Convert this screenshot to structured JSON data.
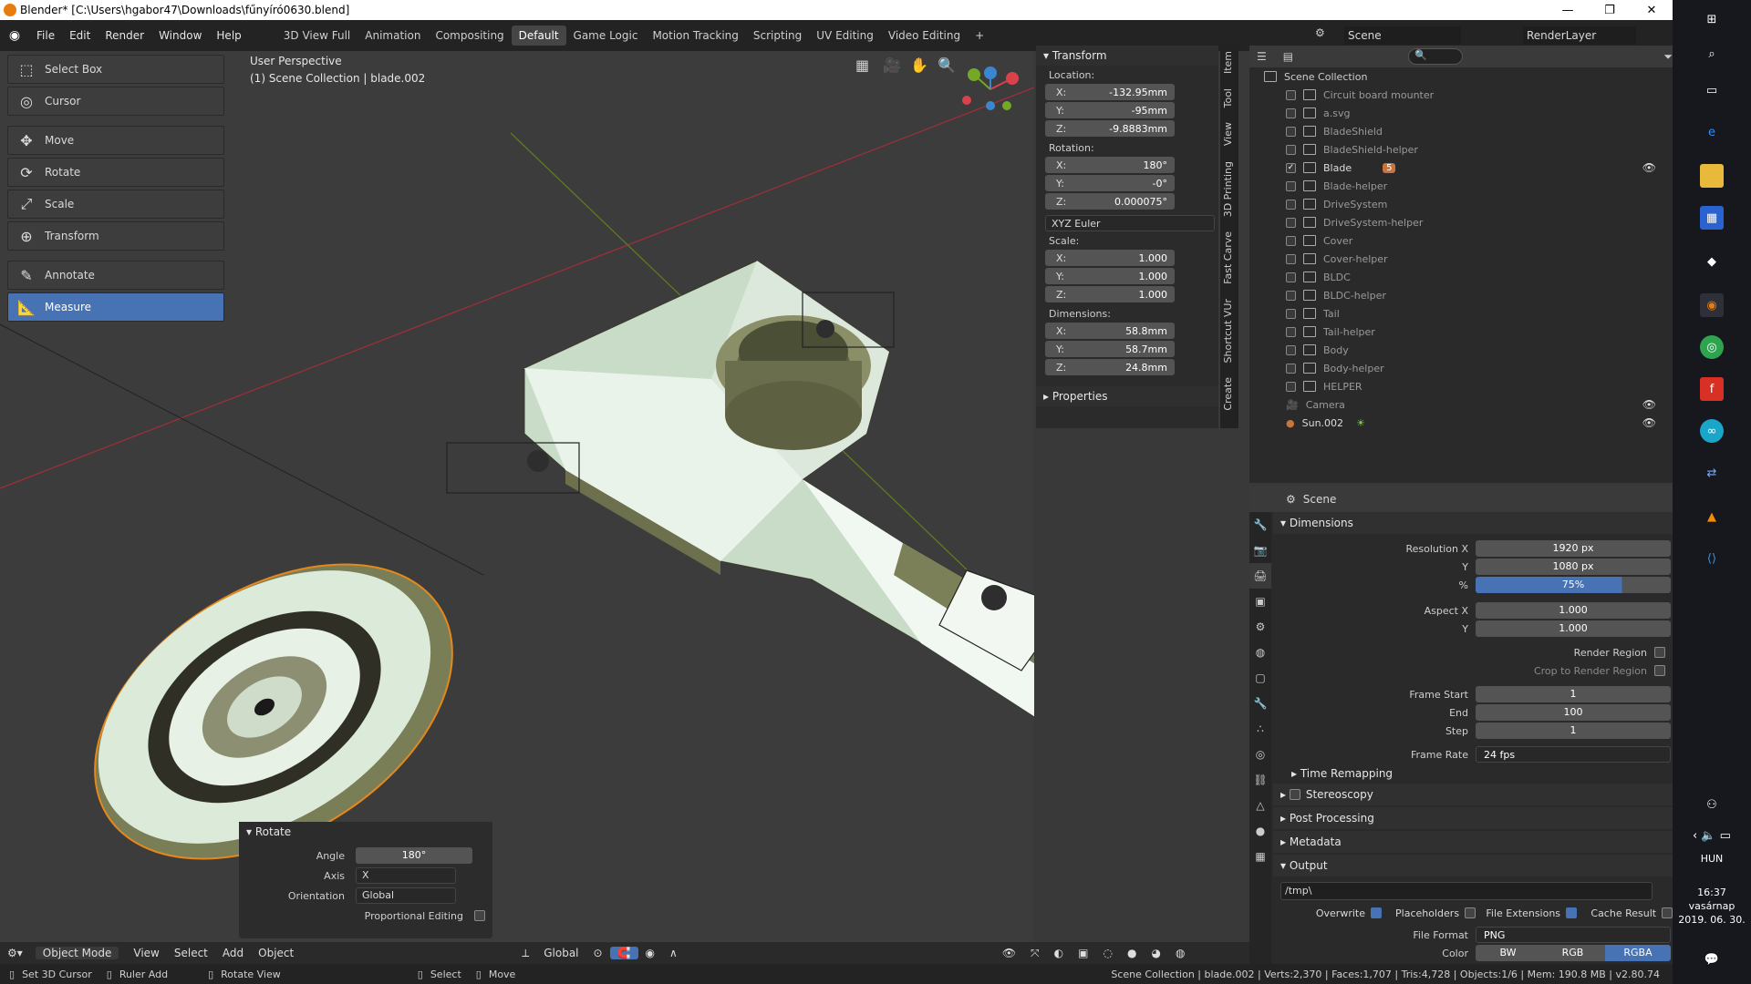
{
  "window": {
    "title": "Blender* [C:\\Users\\hgabor47\\Downloads\\fűnyíró0630.blend]",
    "min": "—",
    "max": "❐",
    "close": "✕"
  },
  "menu": {
    "items": [
      "File",
      "Edit",
      "Render",
      "Window",
      "Help"
    ]
  },
  "workspaces": {
    "tabs": [
      "3D View Full",
      "Animation",
      "Compositing",
      "Default",
      "Game Logic",
      "Motion Tracking",
      "Scripting",
      "UV Editing",
      "Video Editing"
    ],
    "active": "Default",
    "add": "+"
  },
  "scene_selector": {
    "scene": "Scene",
    "renderlayer": "RenderLayer"
  },
  "toolbar": {
    "tools": [
      "Select Box",
      "Cursor",
      "Move",
      "Rotate",
      "Scale",
      "Transform",
      "Annotate",
      "Measure"
    ],
    "active": "Measure"
  },
  "viewport": {
    "perspective": "User Perspective",
    "collection": "(1) Scene Collection | blade.002",
    "gizmo": {
      "x": "X",
      "y": "Y",
      "z": "Z"
    }
  },
  "transform": {
    "header": "Transform",
    "location_label": "Location:",
    "location": [
      {
        "axis": "X:",
        "value": "-132.95mm"
      },
      {
        "axis": "Y:",
        "value": "-95mm"
      },
      {
        "axis": "Z:",
        "value": "-9.8883mm"
      }
    ],
    "rotation_label": "Rotation:",
    "rotation": [
      {
        "axis": "X:",
        "value": "180°"
      },
      {
        "axis": "Y:",
        "value": "-0°"
      },
      {
        "axis": "Z:",
        "value": "0.000075°"
      }
    ],
    "rotation_mode": "XYZ Euler",
    "scale_label": "Scale:",
    "scale": [
      {
        "axis": "X:",
        "value": "1.000"
      },
      {
        "axis": "Y:",
        "value": "1.000"
      },
      {
        "axis": "Z:",
        "value": "1.000"
      }
    ],
    "dimensions_label": "Dimensions:",
    "dimensions": [
      {
        "axis": "X:",
        "value": "58.8mm"
      },
      {
        "axis": "Y:",
        "value": "58.7mm"
      },
      {
        "axis": "Z:",
        "value": "24.8mm"
      }
    ],
    "properties": "Properties"
  },
  "sidebar_tabs": [
    "Item",
    "Tool",
    "View",
    "3D Printing",
    "Fast Carve",
    "Shortcut VUr",
    "Create"
  ],
  "outliner": {
    "root": "Scene Collection",
    "items": [
      {
        "name": "Circuit board mounter",
        "checked": false
      },
      {
        "name": "a.svg",
        "checked": false
      },
      {
        "name": "BladeShield",
        "checked": false
      },
      {
        "name": "BladeShield-helper",
        "checked": false
      },
      {
        "name": "Blade",
        "checked": true,
        "badge": "5"
      },
      {
        "name": "Blade-helper",
        "checked": false
      },
      {
        "name": "DriveSystem",
        "checked": false
      },
      {
        "name": "DriveSystem-helper",
        "checked": false
      },
      {
        "name": "Cover",
        "checked": false
      },
      {
        "name": "Cover-helper",
        "checked": false
      },
      {
        "name": "BLDC",
        "checked": false
      },
      {
        "name": "BLDC-helper",
        "checked": false
      },
      {
        "name": "Tail",
        "checked": false
      },
      {
        "name": "Tail-helper",
        "checked": false
      },
      {
        "name": "Body",
        "checked": false
      },
      {
        "name": "Body-helper",
        "checked": false
      },
      {
        "name": "HELPER",
        "checked": false
      }
    ],
    "objects": [
      {
        "name": "Camera"
      },
      {
        "name": "Sun.002"
      }
    ]
  },
  "properties": {
    "header": "Scene",
    "dimensions": "Dimensions",
    "resolution_x_label": "Resolution X",
    "resolution_x": "1920 px",
    "resolution_y_label": "Y",
    "resolution_y": "1080 px",
    "percent_label": "%",
    "percent": "75%",
    "percent_value": 0.75,
    "aspect_x_label": "Aspect X",
    "aspect_x": "1.000",
    "aspect_y_label": "Y",
    "aspect_y": "1.000",
    "render_region": "Render Region",
    "crop_region": "Crop to Render Region",
    "frame_start_label": "Frame Start",
    "frame_start": "1",
    "end_label": "End",
    "end": "100",
    "step_label": "Step",
    "step": "1",
    "frame_rate_label": "Frame Rate",
    "frame_rate": "24 fps",
    "time_remapping": "Time Remapping",
    "stereoscopy": "Stereoscopy",
    "post_processing": "Post Processing",
    "metadata": "Metadata",
    "output": "Output",
    "output_path": "/tmp\\",
    "overwrite": "Overwrite",
    "placeholders": "Placeholders",
    "file_extensions": "File Extensions",
    "cache_result": "Cache Result",
    "file_format_label": "File Format",
    "file_format": "PNG",
    "color_label": "Color",
    "color_options": [
      "BW",
      "RGB",
      "RGBA"
    ],
    "color_active": "RGBA"
  },
  "rotate_panel": {
    "title": "Rotate",
    "angle_label": "Angle",
    "angle": "180°",
    "axis_label": "Axis",
    "axis": "X",
    "orientation_label": "Orientation",
    "orientation": "Global",
    "proportional": "Proportional Editing"
  },
  "view_header": {
    "mode": "Object Mode",
    "menus": [
      "View",
      "Select",
      "Add",
      "Object"
    ],
    "orientation": "Global"
  },
  "statusbar": {
    "left": [
      "Set 3D Cursor",
      "Ruler Add",
      "Rotate View",
      "Select",
      "Move"
    ],
    "right": "Scene Collection | blade.002 | Verts:2,370 | Faces:1,707 | Tris:4,728 | Objects:1/6 | Mem: 190.8 MB | v2.80.74"
  },
  "os": {
    "language": "HUN",
    "time": "16:37",
    "day": "vasárnap",
    "date": "2019. 06. 30."
  }
}
